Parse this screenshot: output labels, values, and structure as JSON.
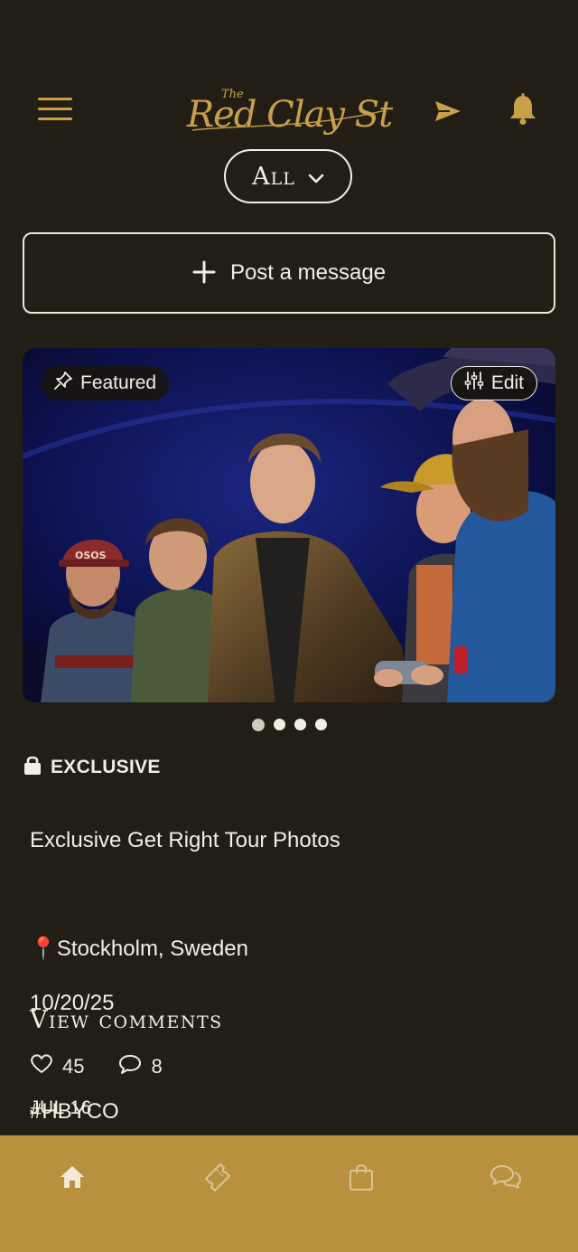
{
  "header": {
    "logo_text": "The Red Clay Strays",
    "filter_label": "All",
    "icons": {
      "menu": "hamburger-menu-icon",
      "send": "send-icon",
      "bell": "bell-icon",
      "chevron": "chevron-down-icon"
    }
  },
  "composer": {
    "post_label": "Post a message"
  },
  "post": {
    "featured_label": "Featured",
    "edit_label": "Edit",
    "carousel": {
      "count": 4,
      "active_index": 0
    },
    "access_label": "EXCLUSIVE",
    "title": "Exclusive Get Right Tour Photos",
    "location_pin": "📍",
    "location": "Stockholm, Sweden",
    "event_date": "10/20/25",
    "hashtag": "#HBYCO",
    "view_comments_label": "View comments",
    "likes": "45",
    "comments": "8",
    "posted_date": "JUL 16"
  },
  "bottom_nav": {
    "items": [
      {
        "name": "home",
        "icon": "home-icon",
        "active": true
      },
      {
        "name": "tickets",
        "icon": "ticket-icon",
        "active": false
      },
      {
        "name": "shop",
        "icon": "shopping-bag-icon",
        "active": false
      },
      {
        "name": "chat",
        "icon": "chat-bubbles-icon",
        "active": false
      }
    ]
  },
  "colors": {
    "background": "#221e16",
    "accent_gold": "#c9a048",
    "nav_bar": "#b8913e",
    "text": "#f3eee4"
  }
}
